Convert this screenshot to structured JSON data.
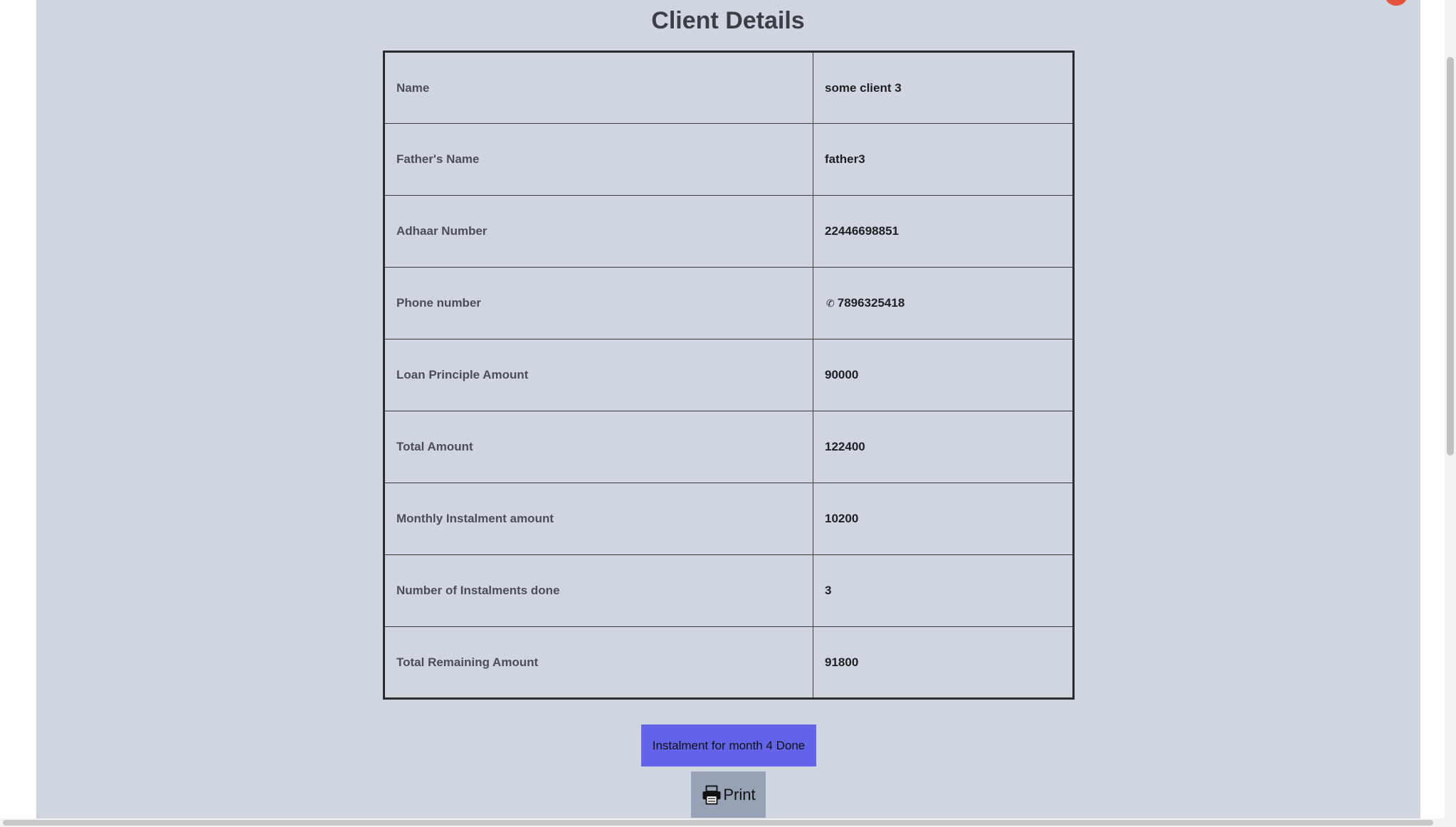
{
  "page": {
    "title": "Client Details"
  },
  "details": {
    "rows": [
      {
        "label": "Name",
        "value": "some client 3"
      },
      {
        "label": "Father's Name",
        "value": "father3"
      },
      {
        "label": "Adhaar Number",
        "value": "22446698851"
      },
      {
        "label": "Phone number",
        "value": "7896325418"
      },
      {
        "label": "Loan Principle Amount",
        "value": "90000"
      },
      {
        "label": "Total Amount",
        "value": "122400"
      },
      {
        "label": "Monthly Instalment amount",
        "value": "10200"
      },
      {
        "label": "Number of Instalments done",
        "value": "3"
      },
      {
        "label": "Total Remaining Amount",
        "value": "91800"
      }
    ]
  },
  "actions": {
    "instalment_label": "Instalment for month 4 Done",
    "print_label": "Print"
  },
  "icons": {
    "phone": "phone-icon",
    "printer": "printer-icon",
    "close": "close-icon"
  },
  "colors": {
    "panel_bg": "#cfd6e0",
    "instalment_button": "#6164e8",
    "print_button": "#97a3b4",
    "close_dot": "#e5533d"
  }
}
